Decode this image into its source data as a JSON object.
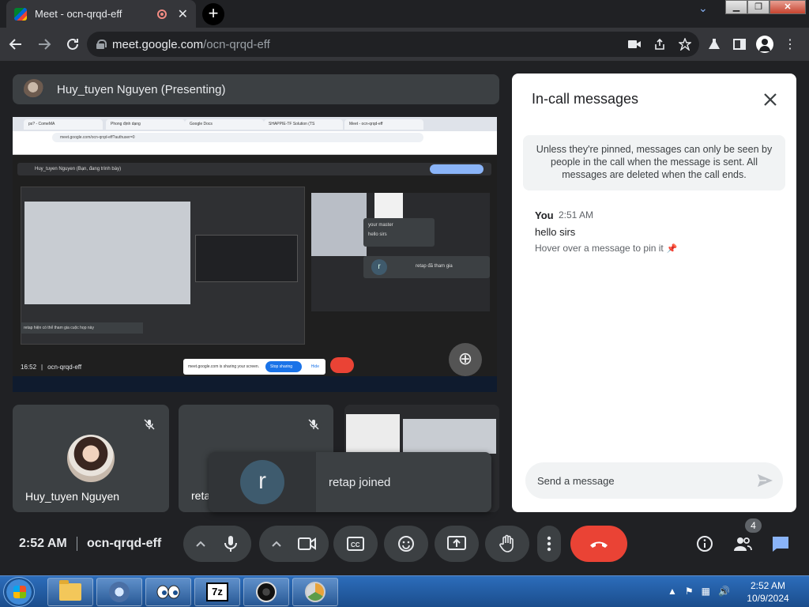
{
  "browser": {
    "tab_title": "Meet - ocn-qrqd-eff",
    "url_host": "meet.google.com",
    "url_path": "/ocn-qrqd-eff"
  },
  "presenter": {
    "label": "Huy_tuyen Nguyen (Presenting)"
  },
  "shared_screen": {
    "tabs": [
      "ps? - ComeMA",
      "Phong định dạng",
      "Google Docs",
      "SHAPPIE-TF Solution (TS",
      "Meet - ocn-qrqd-eff"
    ],
    "url": "meet.google.com/ocn-qrqd-eff?authuser=0",
    "header": "Huy_tuyen Nguyen (Bạn, đang trình bày)",
    "header_button": "Dừng trình bày",
    "chat_sender": "your master",
    "chat_text": "hello sirs",
    "card_avatar": "r",
    "card_text": "retap đã tham gia",
    "caption": "retap hiện có thể tham gia cuộc họp này",
    "bottom_time": "16:52",
    "bottom_code": "ocn-qrqd-eff",
    "stop_text": "meet.google.com is sharing your screen.",
    "stop_button": "Stop sharing",
    "hide_button": "Hide"
  },
  "tiles": [
    {
      "name": "Huy_tuyen Nguyen"
    },
    {
      "name": "reta"
    }
  ],
  "toast": {
    "avatar_letter": "r",
    "text": "retap joined"
  },
  "chat_panel": {
    "title": "In-call messages",
    "notice": "Unless they're pinned, messages can only be seen by people in the call when the message is sent. All messages are deleted when the call ends.",
    "message": {
      "sender": "You",
      "time": "2:51 AM",
      "text": "hello sirs",
      "hint": "Hover over a message to pin it"
    },
    "compose_placeholder": "Send a message"
  },
  "controls": {
    "time": "2:52 AM",
    "meeting_code": "ocn-qrqd-eff",
    "participant_count": "4"
  },
  "taskbar": {
    "apps": [
      "explorer-icon",
      "system-icon",
      "eyes-icon",
      "7zip-icon",
      "obs-icon",
      "chrome-canary-icon"
    ],
    "app_7z_label": "7z",
    "clock_time": "2:52 AM",
    "clock_date": "10/9/2024"
  },
  "colors": {
    "meet_bg": "#202124",
    "surface": "#3c4043",
    "hangup": "#ea4335",
    "chat_blue": "#8ab4f8"
  }
}
